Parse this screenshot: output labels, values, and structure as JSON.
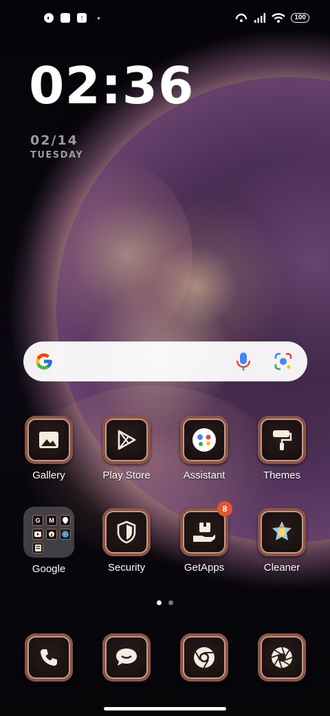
{
  "status_bar": {
    "left_icons": [
      "app-icon",
      "square-icon",
      "upload-icon"
    ],
    "battery": "100"
  },
  "clock": {
    "time": "02:36",
    "date": "02/14",
    "day": "TUESDAY"
  },
  "search": {
    "brand": "google-g-logo",
    "mic": "microphone-icon",
    "lens": "lens-camera-icon"
  },
  "apps": [
    {
      "label": "Gallery",
      "icon": "image-icon"
    },
    {
      "label": "Play Store",
      "icon": "play-store-icon"
    },
    {
      "label": "Assistant",
      "icon": "assistant-icon"
    },
    {
      "label": "Themes",
      "icon": "paint-roller-icon"
    },
    {
      "label": "Google",
      "icon": "folder-icon"
    },
    {
      "label": "Security",
      "icon": "shield-icon"
    },
    {
      "label": "GetApps",
      "icon": "getapps-icon",
      "badge": "8"
    },
    {
      "label": "Cleaner",
      "icon": "cleaner-icon"
    }
  ],
  "folder_letters": [
    "G",
    "M",
    "",
    "",
    "",
    "",
    "",
    ""
  ],
  "dock": [
    {
      "name": "phone",
      "icon": "phone-icon"
    },
    {
      "name": "messages",
      "icon": "message-icon"
    },
    {
      "name": "chrome",
      "icon": "chrome-icon"
    },
    {
      "name": "camera",
      "icon": "camera-aperture-icon"
    }
  ],
  "pager": {
    "pages": 2,
    "active": 1
  },
  "colors": {
    "badge": "#e8542b",
    "search_bg": "#ffffff",
    "tile_frame": "#c89a86"
  }
}
